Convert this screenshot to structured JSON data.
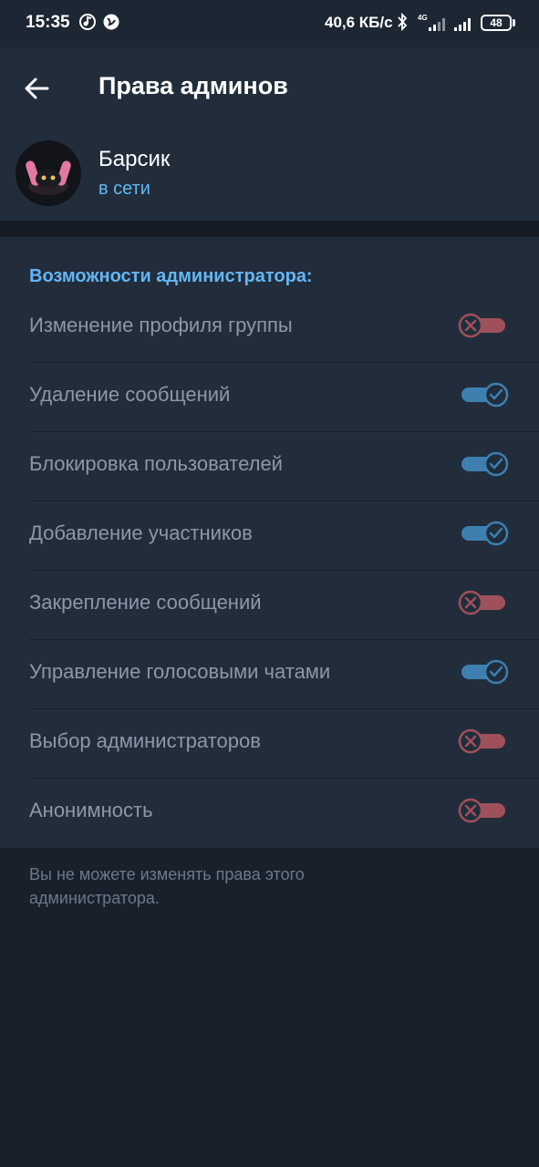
{
  "status_bar": {
    "time": "15:35",
    "network_speed": "40,6 КБ/с",
    "network_type": "4G",
    "battery": "48"
  },
  "app_bar": {
    "back_icon": "arrow-left-icon",
    "title": "Права админов"
  },
  "profile": {
    "name": "Барсик",
    "status": "в сети"
  },
  "permissions": {
    "header": "Возможности администратора:",
    "items": [
      {
        "label": "Изменение профиля группы",
        "enabled": false
      },
      {
        "label": "Удаление сообщений",
        "enabled": true
      },
      {
        "label": "Блокировка пользователей",
        "enabled": true
      },
      {
        "label": "Добавление участников",
        "enabled": true
      },
      {
        "label": "Закрепление сообщений",
        "enabled": false
      },
      {
        "label": "Управление голосовыми чатами",
        "enabled": true
      },
      {
        "label": "Выбор администраторов",
        "enabled": false
      },
      {
        "label": "Анонимность",
        "enabled": false
      }
    ]
  },
  "footer_note": "Вы не можете изменять права этого администратора.",
  "colors": {
    "background": "#18202b",
    "panel": "#212d3b",
    "accent_blue": "#64b5f6",
    "toggle_on": "#3f7fb0",
    "toggle_off": "#a0505c"
  }
}
